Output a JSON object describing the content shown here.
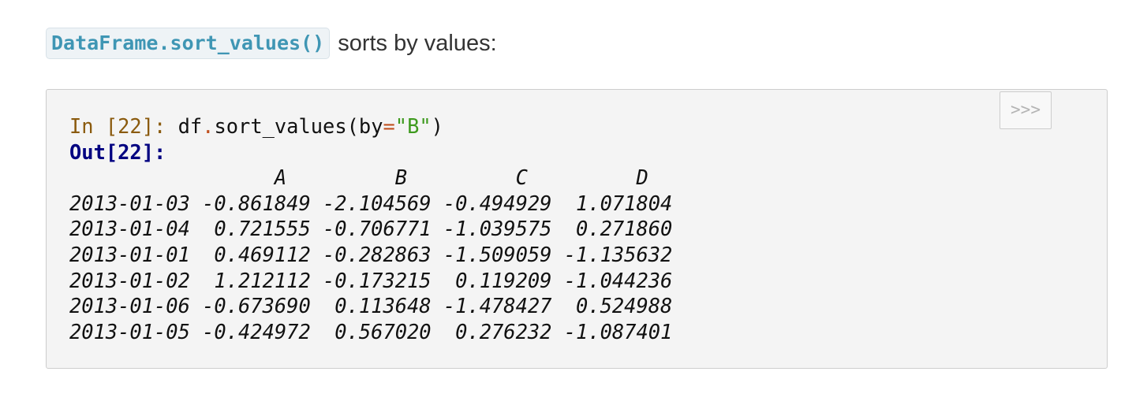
{
  "intro": {
    "code": "DataFrame.sort_values()",
    "text": "sorts by values:"
  },
  "code_block": {
    "copy_button": ">>>",
    "input": {
      "prompt": "In [22]:",
      "obj": "df",
      "dot": ".",
      "method": "sort_values(by",
      "eq": "=",
      "arg": "\"B\"",
      "close": ")"
    },
    "output_prompt": "Out[22]:",
    "output_lines": [
      "                 A         B         C         D",
      "2013-01-03 -0.861849 -2.104569 -0.494929  1.071804",
      "2013-01-04  0.721555 -0.706771 -1.039575  0.271860",
      "2013-01-01  0.469112 -0.282863 -1.509059 -1.135632",
      "2013-01-02  1.212112 -0.173215  0.119209 -1.044236",
      "2013-01-06 -0.673690  0.113648 -1.478427  0.524988",
      "2013-01-05 -0.424972  0.567020  0.276232 -1.087401"
    ]
  }
}
